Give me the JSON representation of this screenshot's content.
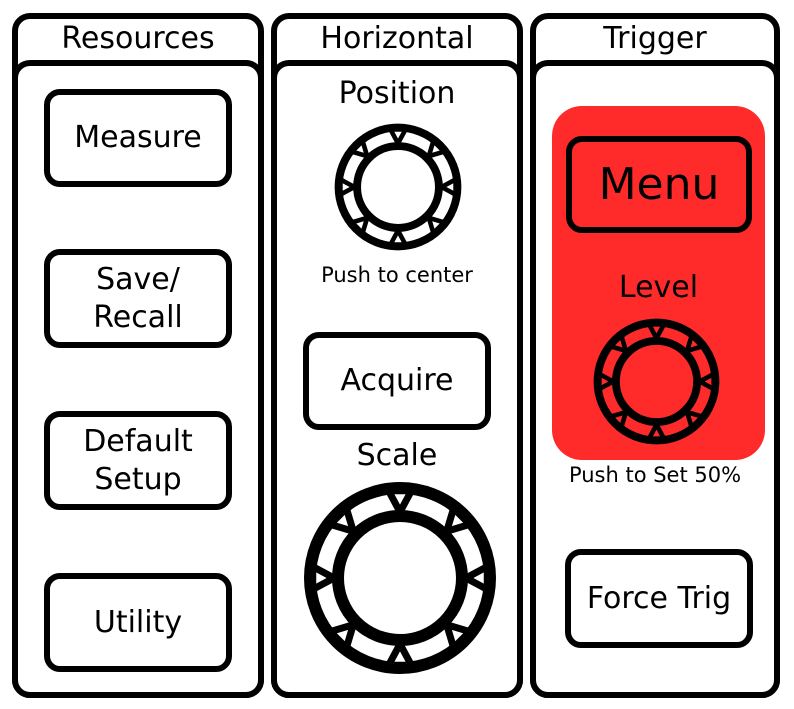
{
  "colors": {
    "stroke": "#000000",
    "background": "#ffffff",
    "trigger_highlight": "#ff2a2a"
  },
  "panels": {
    "resources": {
      "title": "Resources",
      "buttons": [
        {
          "label_lines": [
            "Measure"
          ]
        },
        {
          "label_lines": [
            "Save/",
            "Recall"
          ]
        },
        {
          "label_lines": [
            "Default",
            "Setup"
          ]
        },
        {
          "label_lines": [
            "Utility"
          ]
        }
      ]
    },
    "horizontal": {
      "title": "Horizontal",
      "position_label": "Position",
      "position_knob_icon": "rotary-knob",
      "position_caption": "Push to center",
      "acquire_label": "Acquire",
      "scale_label": "Scale",
      "scale_knob_icon": "rotary-knob"
    },
    "trigger": {
      "title": "Trigger",
      "menu_label": "Menu",
      "level_label": "Level",
      "level_knob_icon": "rotary-knob",
      "level_caption": "Push to Set 50%",
      "force_trig_label": "Force Trig"
    }
  }
}
